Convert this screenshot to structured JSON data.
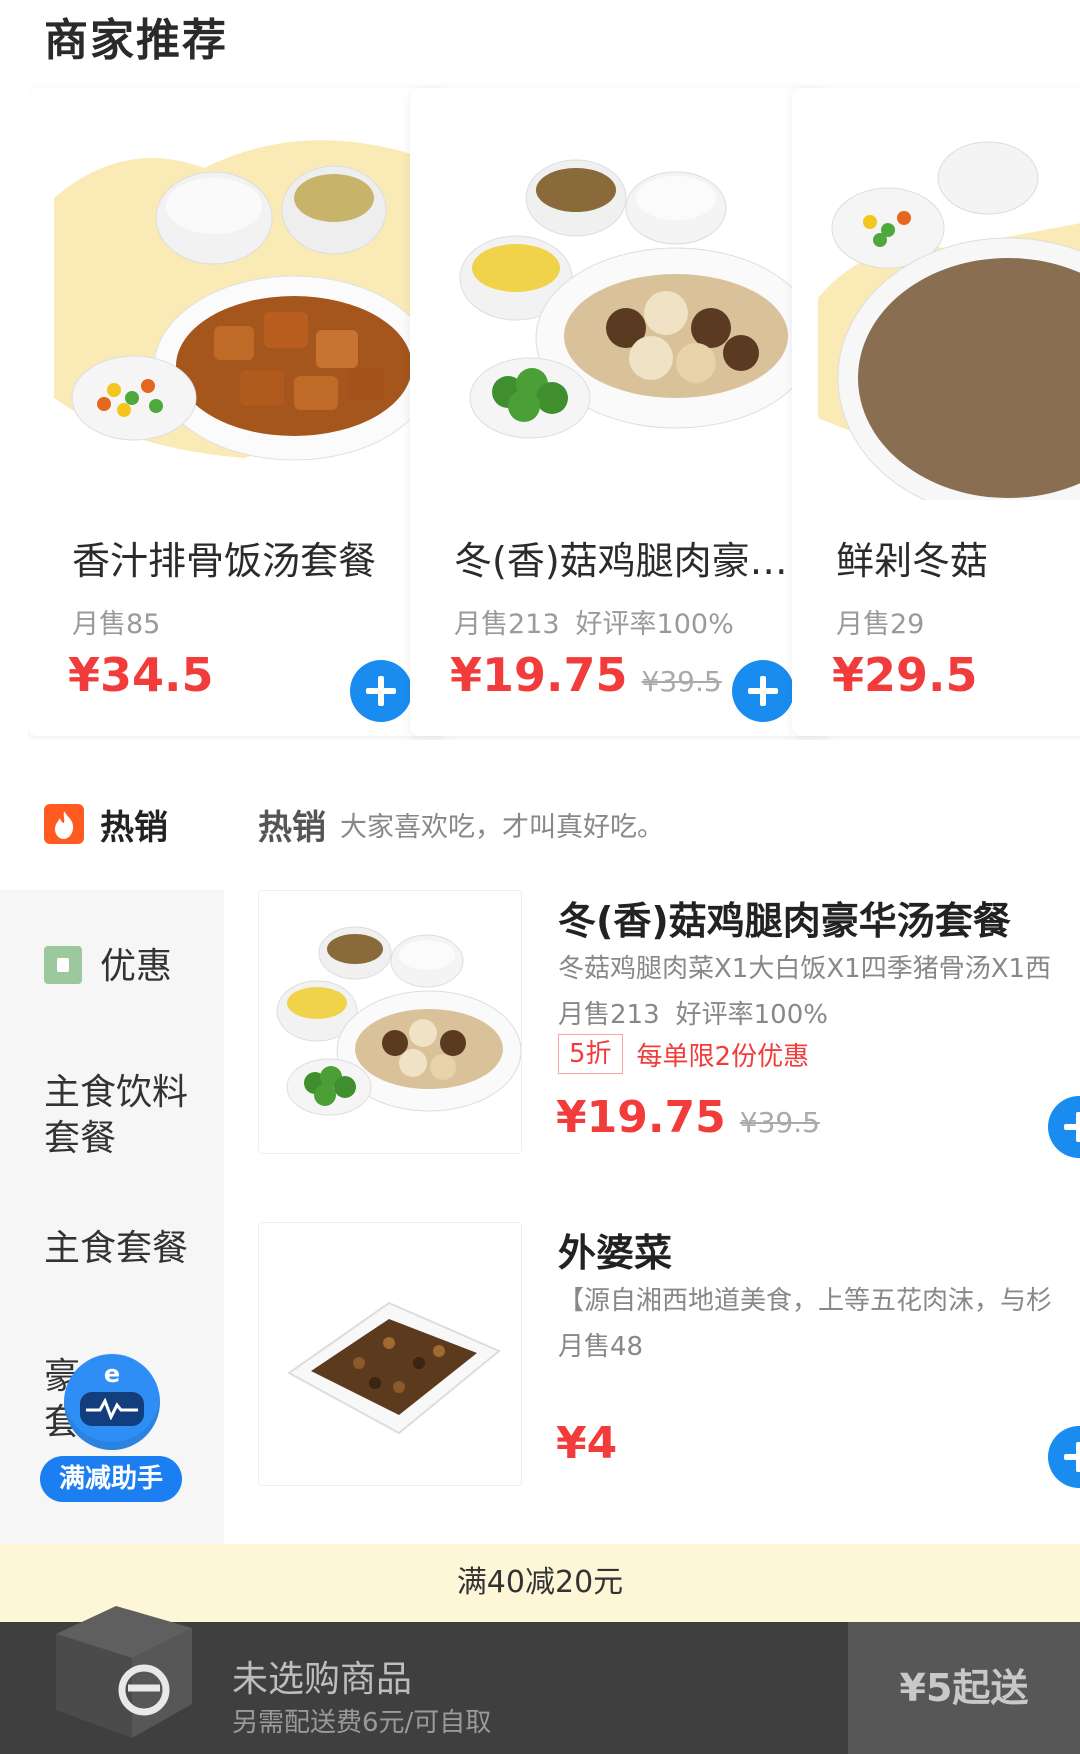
{
  "section_title": "商家推荐",
  "recommend": [
    {
      "name": "香汁排骨饭汤套餐",
      "sales": "月售85",
      "rating": "",
      "price": "¥34.5",
      "original_price": ""
    },
    {
      "name": "冬(香)菇鸡腿肉豪…",
      "sales": "月售213",
      "rating": "好评率100%",
      "price": "¥19.75",
      "original_price": "¥39.5"
    },
    {
      "name": "鲜剁冬菇",
      "sales": "月售29",
      "rating": "",
      "price": "¥29.5",
      "original_price": ""
    }
  ],
  "hot": {
    "tab_label": "热销",
    "header_title": "热销",
    "header_desc": "大家喜欢吃，才叫真好吃。"
  },
  "sidebar": {
    "items": [
      {
        "label": "优惠"
      },
      {
        "label": "主食饮料\n套餐"
      },
      {
        "label": "主食套餐"
      },
      {
        "label": "豪\n套"
      }
    ]
  },
  "assistant": {
    "label": "满减助手"
  },
  "products": [
    {
      "name": "冬(香)菇鸡腿肉豪华汤套餐",
      "desc": "冬菇鸡腿肉菜X1大白饭X1四季猪骨汤X1西",
      "sales": "月售213",
      "rating": "好评率100%",
      "discount_badge": "5折",
      "limit_text": "每单限2份优惠",
      "price": "¥19.75",
      "original_price": "¥39.5"
    },
    {
      "name": "外婆菜",
      "desc": "【源自湘西地道美食，上等五花肉沫，与杉",
      "sales": "月售48",
      "price": "¥4"
    }
  ],
  "promo_banner": "满40减20元",
  "cart": {
    "title": "未选购商品",
    "subtitle": "另需配送费6元/可自取",
    "checkout_label": "¥5起送"
  },
  "colors": {
    "accent_blue": "#1a8cf0",
    "price_red": "#f23c3c",
    "banner_yellow": "#fdf6d7",
    "cart_bar": "#3f3f3f"
  }
}
